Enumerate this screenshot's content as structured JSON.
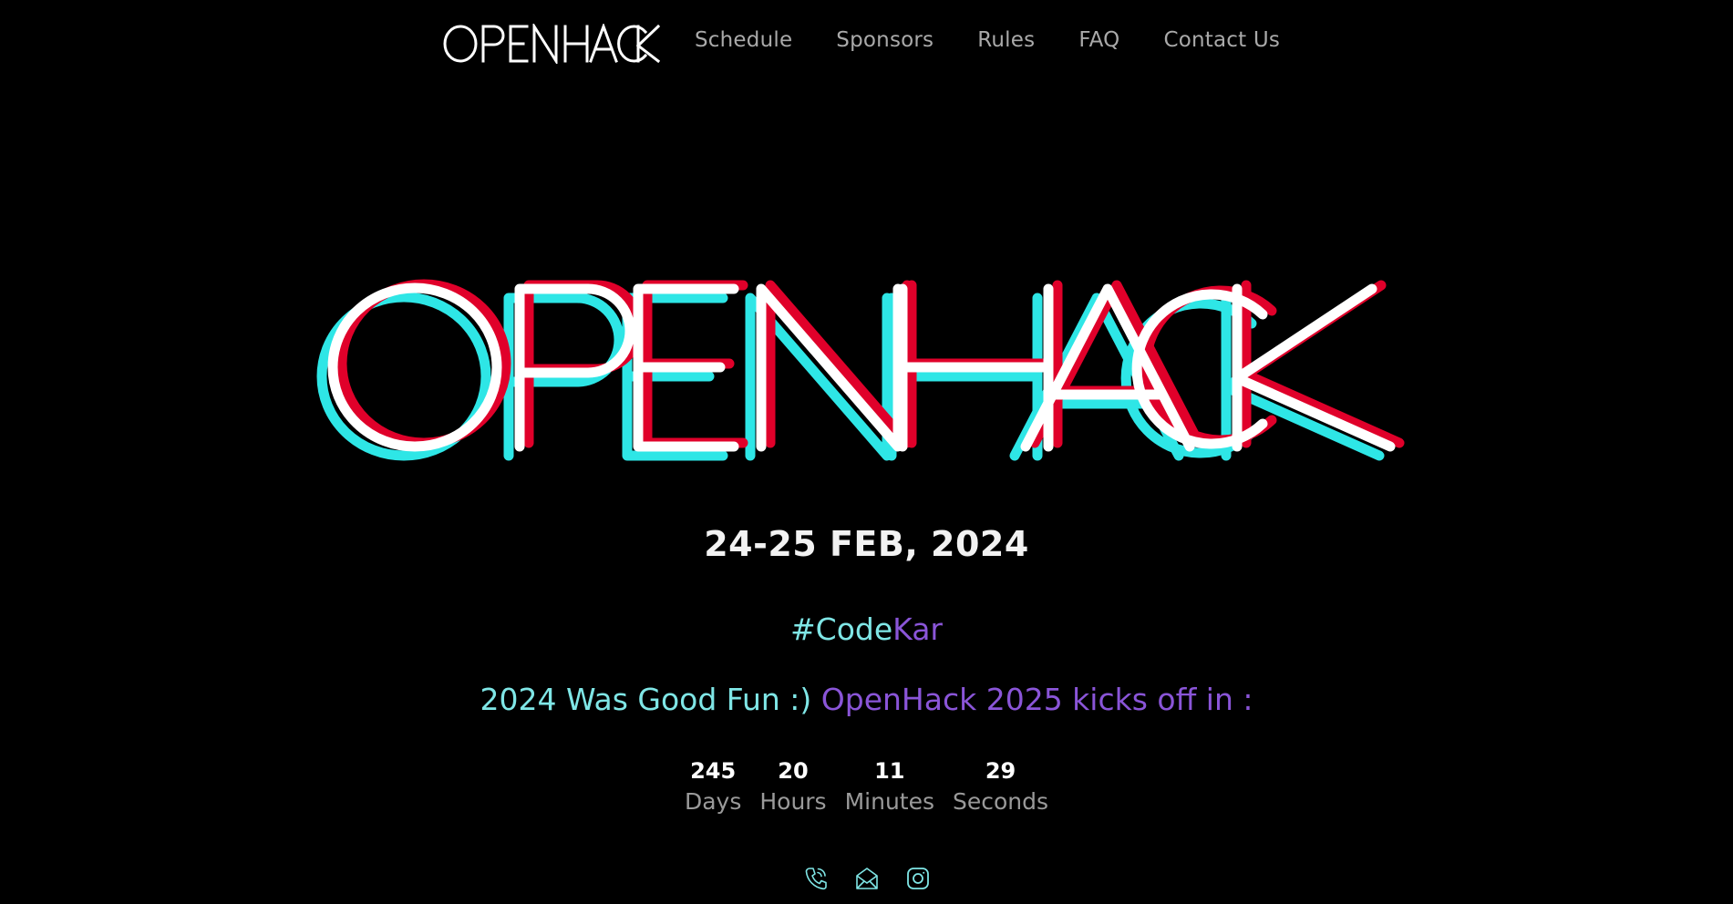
{
  "nav": {
    "logo_text": "OPENHACK",
    "links": [
      {
        "label": "Schedule"
      },
      {
        "label": "Sponsors"
      },
      {
        "label": "Rules"
      },
      {
        "label": "FAQ"
      },
      {
        "label": "Contact Us"
      }
    ]
  },
  "hero": {
    "logo_text": "OPENHACK",
    "date": "24-25 FEB, 2024",
    "tagline_part1": "#Code",
    "tagline_part2": "Kar",
    "announce_part1": "2024 Was Good Fun :)",
    "announce_part2": "OpenHack 2025 kicks off in :"
  },
  "countdown": [
    {
      "value": "245",
      "label": "Days"
    },
    {
      "value": "20",
      "label": "Hours"
    },
    {
      "value": "11",
      "label": "Minutes"
    },
    {
      "value": "29",
      "label": "Seconds"
    }
  ],
  "social": [
    {
      "icon": "phone-icon"
    },
    {
      "icon": "mail-icon"
    },
    {
      "icon": "instagram-icon"
    }
  ],
  "colors": {
    "background": "#000000",
    "cyan": "#7fe6e6",
    "purple": "#8a55d8",
    "glitch_red": "#e0002a",
    "glitch_cyan": "#2ee6e6",
    "nav_text": "#a9a9a9"
  }
}
